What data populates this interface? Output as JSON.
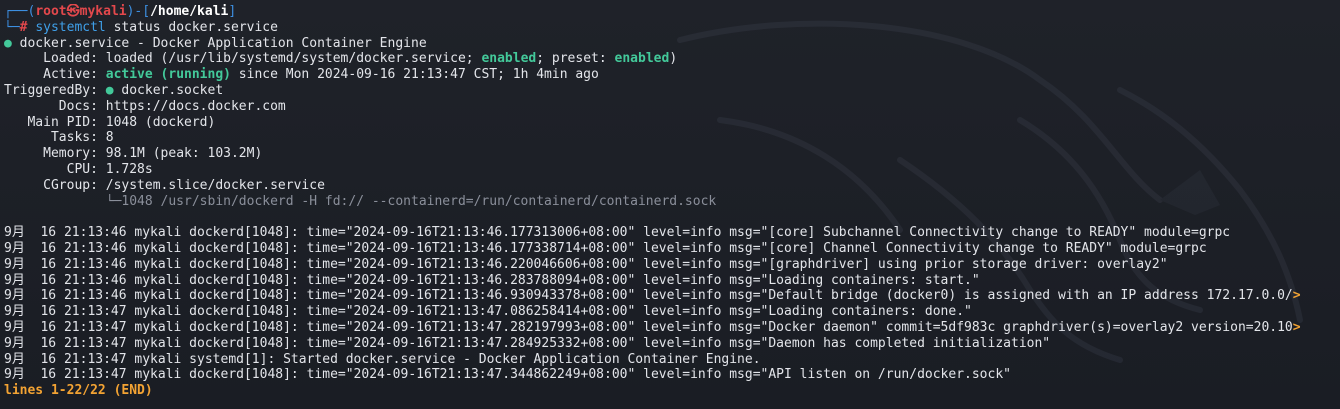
{
  "prompt": {
    "top_left": "┌──(",
    "user": "root",
    "at_symbol": "㉿",
    "host": "mykali",
    "sep": ")-[",
    "cwd": "/home/kali",
    "close": "]",
    "bottom_left": "└─",
    "hash": "#",
    "cmd_name": "systemctl",
    "cmd_args": " status docker.service"
  },
  "status": {
    "dot": "●",
    "unit_line": " docker.service - Docker Application Container Engine",
    "loaded_label": "     Loaded:",
    "loaded_pre": " loaded (/usr/lib/systemd/system/docker.service; ",
    "loaded_enabled": "enabled",
    "loaded_mid": "; preset: ",
    "loaded_preset": "enabled",
    "loaded_end": ")",
    "active_label": "     Active:",
    "active_state": " active (running)",
    "active_rest": " since Mon 2024-09-16 21:13:47 CST; 1h 4min ago",
    "triggered_label": "TriggeredBy:",
    "triggered_dot": " ●",
    "triggered_value": " docker.socket",
    "docs_label": "       Docs:",
    "docs_value": " https://docs.docker.com",
    "mainpid_label": "   Main PID:",
    "mainpid_value": " 1048 (dockerd)",
    "tasks_label": "      Tasks:",
    "tasks_value": " 8",
    "memory_label": "     Memory:",
    "memory_value": " 98.1M (peak: 103.2M)",
    "cpu_label": "        CPU:",
    "cpu_value": " 1.728s",
    "cgroup_label": "     CGroup:",
    "cgroup_value": " /system.slice/docker.service",
    "cgroup_tree": "             └─1048 /usr/sbin/dockerd -H fd:// --containerd=/run/containerd/containerd.sock"
  },
  "journal": [
    "9月  16 21:13:46 mykali dockerd[1048]: time=\"2024-09-16T21:13:46.177313006+08:00\" level=info msg=\"[core] Subchannel Connectivity change to READY\" module=grpc",
    "9月  16 21:13:46 mykali dockerd[1048]: time=\"2024-09-16T21:13:46.177338714+08:00\" level=info msg=\"[core] Channel Connectivity change to READY\" module=grpc",
    "9月  16 21:13:46 mykali dockerd[1048]: time=\"2024-09-16T21:13:46.220046606+08:00\" level=info msg=\"[graphdriver] using prior storage driver: overlay2\"",
    "9月  16 21:13:46 mykali dockerd[1048]: time=\"2024-09-16T21:13:46.283788094+08:00\" level=info msg=\"Loading containers: start.\"",
    "9月  16 21:13:46 mykali dockerd[1048]: time=\"2024-09-16T21:13:46.930943378+08:00\" level=info msg=\"Default bridge (docker0) is assigned with an IP address 172.17.0.0/",
    "9月  16 21:13:47 mykali dockerd[1048]: time=\"2024-09-16T21:13:47.086258414+08:00\" level=info msg=\"Loading containers: done.\"",
    "9月  16 21:13:47 mykali dockerd[1048]: time=\"2024-09-16T21:13:47.282197993+08:00\" level=info msg=\"Docker daemon\" commit=5df983c graphdriver(s)=overlay2 version=20.10",
    "9月  16 21:13:47 mykali dockerd[1048]: time=\"2024-09-16T21:13:47.284925332+08:00\" level=info msg=\"Daemon has completed initialization\"",
    "9月  16 21:13:47 mykali systemd[1]: Started docker.service - Docker Application Container Engine.",
    "9月  16 21:13:47 mykali dockerd[1048]: time=\"2024-09-16T21:13:47.344862249+08:00\" level=info msg=\"API listen on /run/docker.sock\""
  ],
  "truncation_marker": ">",
  "pager_status": "lines 1-22/22 (END)",
  "colors": {
    "background": "#1c1f27",
    "prompt_blue": "#3d8fe0",
    "prompt_red": "#e3484c",
    "status_green": "#43c99a",
    "pager_orange": "#f3a333",
    "text": "#e3e5ea"
  },
  "icons": {
    "background": "kali-dragon-watermark"
  }
}
